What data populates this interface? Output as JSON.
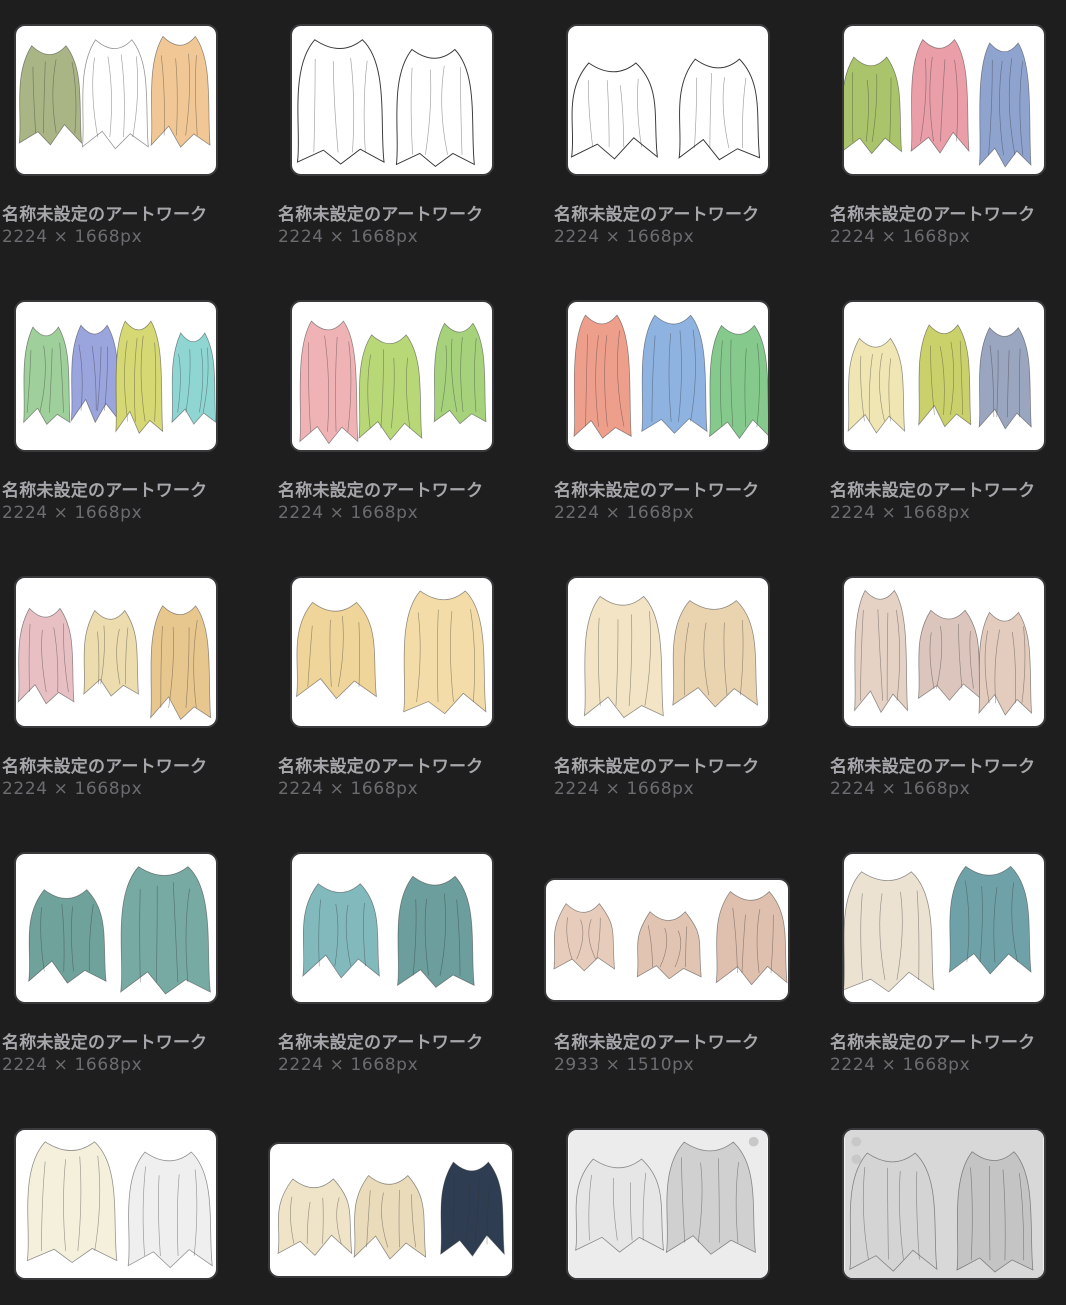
{
  "artworks": [
    {
      "title": "名称未設定のアートワーク",
      "dimensions": "2224 × 1668px",
      "palette": [
        "#a9b584",
        "#ffffff",
        "#f1c895"
      ],
      "style": "color"
    },
    {
      "title": "名称未設定のアートワーク",
      "dimensions": "2224 × 1668px",
      "palette": [
        "#ffffff",
        "#ffffff"
      ],
      "style": "line"
    },
    {
      "title": "名称未設定のアートワーク",
      "dimensions": "2224 × 1668px",
      "palette": [
        "#ffffff",
        "#ffffff"
      ],
      "style": "line"
    },
    {
      "title": "名称未設定のアートワーク",
      "dimensions": "2224 × 1668px",
      "palette": [
        "#a9c46a",
        "#e99ea8",
        "#8fa3cf"
      ],
      "style": "color"
    },
    {
      "title": "名称未設定のアートワーク",
      "dimensions": "2224 × 1668px",
      "palette": [
        "#9fcf9a",
        "#9aa4dd",
        "#d6d873",
        "#8fd6d3"
      ],
      "style": "color"
    },
    {
      "title": "名称未設定のアートワーク",
      "dimensions": "2224 × 1668px",
      "palette": [
        "#f0b3b5",
        "#b8d777",
        "#a6d27c"
      ],
      "style": "color"
    },
    {
      "title": "名称未設定のアートワーク",
      "dimensions": "2224 × 1668px",
      "palette": [
        "#ee9f8c",
        "#8eb3e0",
        "#86c98d"
      ],
      "style": "color"
    },
    {
      "title": "名称未設定のアートワーク",
      "dimensions": "2224 × 1668px",
      "palette": [
        "#efe6b4",
        "#cbd16a",
        "#9aa5bf"
      ],
      "style": "color"
    },
    {
      "title": "名称未設定のアートワーク",
      "dimensions": "2224 × 1668px",
      "palette": [
        "#e8c0c4",
        "#ecdcae",
        "#e8c78f"
      ],
      "style": "color"
    },
    {
      "title": "名称未設定のアートワーク",
      "dimensions": "2224 × 1668px",
      "palette": [
        "#f0d59a",
        "#f3dca8"
      ],
      "style": "color"
    },
    {
      "title": "名称未設定のアートワーク",
      "dimensions": "2224 × 1668px",
      "palette": [
        "#f2e4c4",
        "#ead4b0"
      ],
      "style": "color"
    },
    {
      "title": "名称未設定のアートワーク",
      "dimensions": "2224 × 1668px",
      "palette": [
        "#e6d2c5",
        "#dcc5bd",
        "#e3cbbd"
      ],
      "style": "color"
    },
    {
      "title": "名称未設定のアートワーク",
      "dimensions": "2224 × 1668px",
      "palette": [
        "#6fa29a",
        "#76aaa2"
      ],
      "style": "color"
    },
    {
      "title": "名称未設定のアートワーク",
      "dimensions": "2224 × 1668px",
      "palette": [
        "#82b9bd",
        "#6b9e9c"
      ],
      "style": "color"
    },
    {
      "title": "名称未設定のアートワーク",
      "dimensions": "2933 × 1510px",
      "palette": [
        "#e8ccbb",
        "#e2c4b2",
        "#dfc0ae"
      ],
      "style": "color"
    },
    {
      "title": "名称未設定のアートワーク",
      "dimensions": "2224 × 1668px",
      "palette": [
        "#ebe2d2",
        "#6fa2a8"
      ],
      "style": "color"
    },
    {
      "palette": [
        "#f4f0dc",
        "#efefef"
      ],
      "style": "color"
    },
    {
      "palette": [
        "#efe4c8",
        "#eadbbb",
        "#2e3d52"
      ],
      "style": "color"
    },
    {
      "palette": [
        "#e6e6e6",
        "#d0d0d0"
      ],
      "style": "gray"
    },
    {
      "palette": [
        "#d4d4d4",
        "#c4c4c4"
      ],
      "style": "gray"
    }
  ]
}
